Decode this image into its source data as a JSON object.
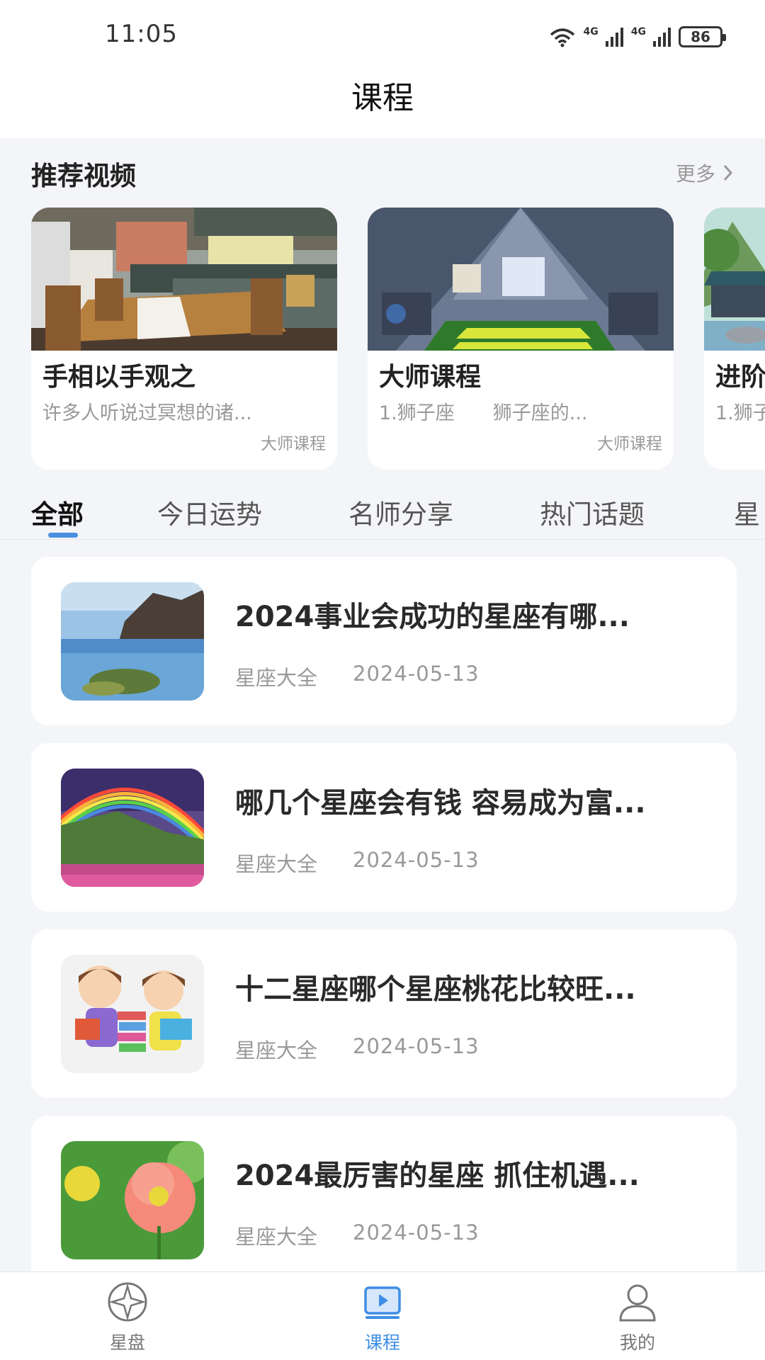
{
  "status_bar": {
    "time": "11:05",
    "battery": "86",
    "network_1": "4G",
    "network_2": "4G"
  },
  "header": {
    "title": "课程"
  },
  "recommended": {
    "title": "推荐视频",
    "more_label": "更多",
    "videos": [
      {
        "title": "手相以手观之",
        "desc": "许多人听说过冥想的诸...",
        "tag": "大师课程"
      },
      {
        "title": "大师课程",
        "desc": "1.狮子座　　狮子座的...",
        "tag": "大师课程"
      },
      {
        "title": "进阶",
        "desc": "1.狮子",
        "tag": ""
      }
    ]
  },
  "tabs": {
    "items": [
      "全部",
      "今日运势",
      "名师分享",
      "热门话题",
      "星"
    ],
    "active_index": 0
  },
  "articles": [
    {
      "title": "2024事业会成功的星座有哪...",
      "source": "星座大全",
      "date": "2024-05-13"
    },
    {
      "title": "哪几个星座会有钱 容易成为富...",
      "source": "星座大全",
      "date": "2024-05-13"
    },
    {
      "title": "十二星座哪个星座桃花比较旺...",
      "source": "星座大全",
      "date": "2024-05-13"
    },
    {
      "title": "2024最厉害的星座 抓住机遇...",
      "source": "星座大全",
      "date": "2024-05-13"
    }
  ],
  "bottom_nav": {
    "items": [
      {
        "label": "星盘",
        "icon": "compass-icon"
      },
      {
        "label": "课程",
        "icon": "video-course-icon"
      },
      {
        "label": "我的",
        "icon": "user-icon"
      }
    ],
    "active_index": 1
  },
  "colors": {
    "accent": "#3f8ee5",
    "tab_indicator": "#4a8fe0",
    "background": "#f4f5f8"
  }
}
